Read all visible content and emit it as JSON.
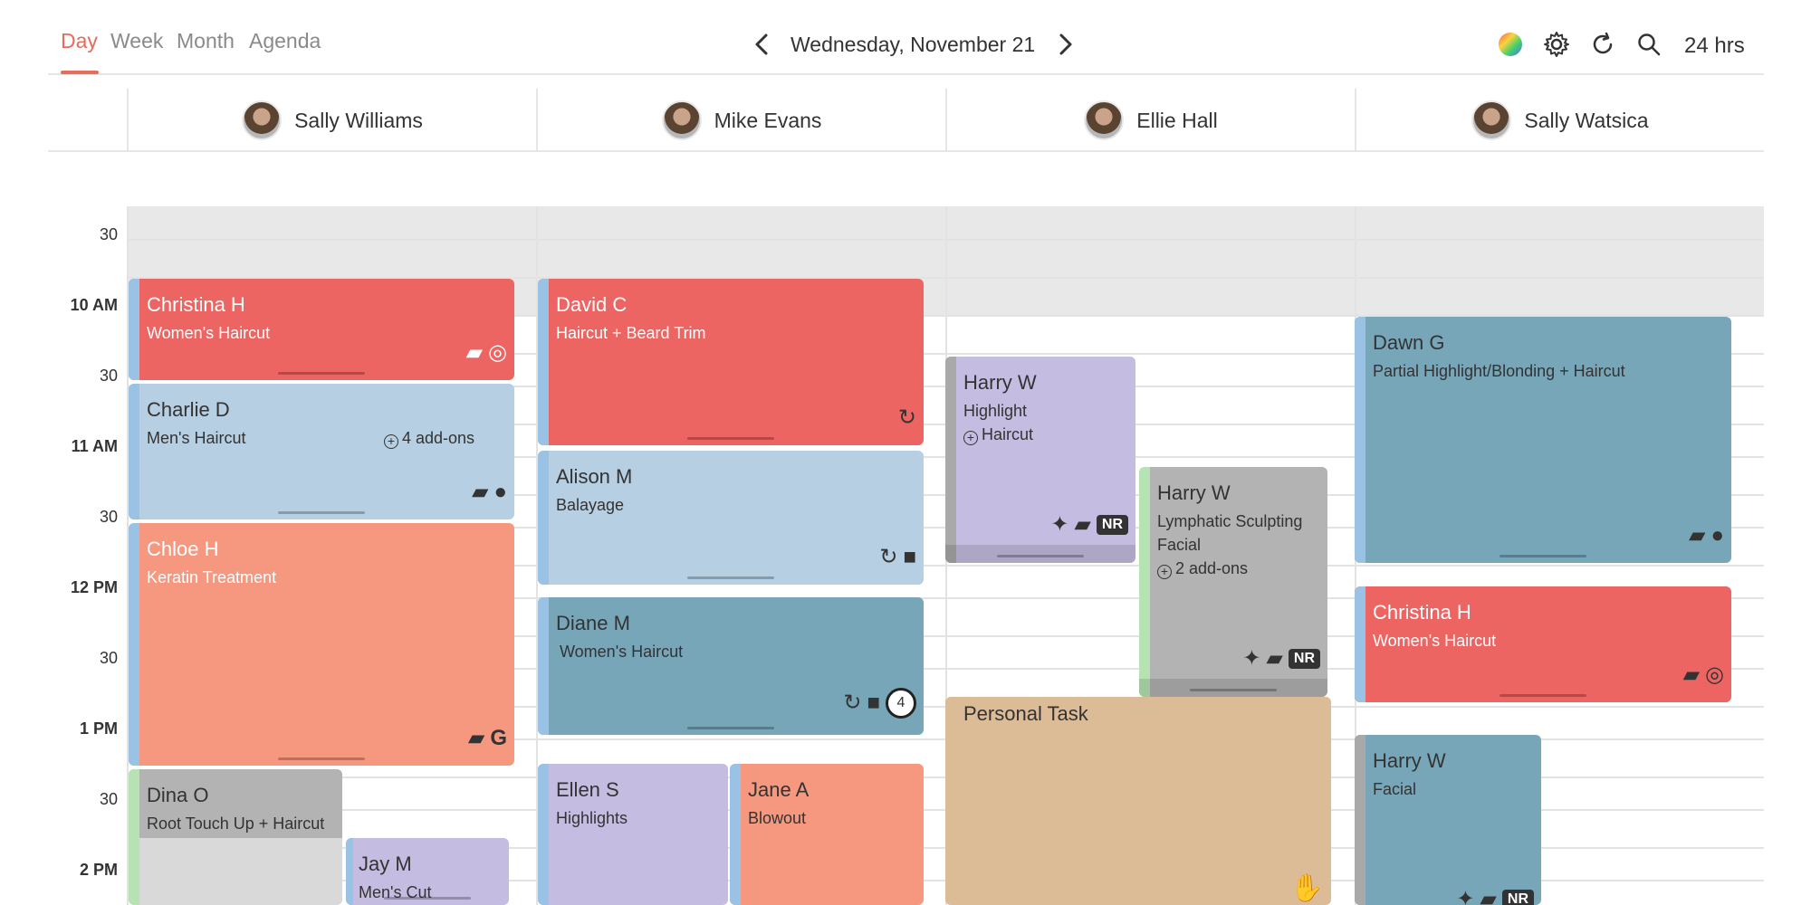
{
  "toolbar": {
    "tabs": [
      "Day",
      "Week",
      "Month",
      "Agenda"
    ],
    "active_tab": "Day",
    "date": "Wednesday, November 21",
    "hours_label": "24 hrs",
    "icons": [
      "color-wheel-icon",
      "gear-icon",
      "refresh-icon",
      "search-icon"
    ]
  },
  "staff": [
    {
      "name": "Sally Williams"
    },
    {
      "name": "Mike Evans"
    },
    {
      "name": "Ellie Hall"
    },
    {
      "name": "Sally Watsica"
    }
  ],
  "time_labels": [
    "30",
    "10 AM",
    "30",
    "11 AM",
    "30",
    "12 PM",
    "30",
    "1 PM",
    "30",
    "2 PM"
  ],
  "colors": {
    "accent": "#e46d5c",
    "red": "#ec6563",
    "light_blue": "#b6cfe2",
    "salmon": "#f69880",
    "grey": "#b3b3b3",
    "lavender": "#c5bde1",
    "teal": "#78a6b9",
    "tan": "#dcbb97"
  },
  "appointments": [
    {
      "client": "Christina H",
      "service": "Women's Haircut",
      "icons": [
        "note-icon",
        "instagram-icon"
      ]
    },
    {
      "client": "Charlie D",
      "service": "Men's Haircut",
      "addons": "4 add-ons",
      "icons": [
        "note-icon",
        "apple-icon"
      ]
    },
    {
      "client": "Chloe H",
      "service": "Keratin Treatment",
      "icons": [
        "note-icon",
        "google-icon"
      ]
    },
    {
      "client": "Dina O",
      "service": "Root Touch Up + Haircut"
    },
    {
      "client": "Jay M",
      "service": "Men's Cut"
    },
    {
      "client": "David C",
      "service": "Haircut + Beard Trim",
      "icons": [
        "recurring-icon"
      ]
    },
    {
      "client": "Alison M",
      "service": "Balayage",
      "icons": [
        "recurring-icon",
        "video-icon"
      ]
    },
    {
      "client": "Diane M",
      "service": "Women's Haircut",
      "count": "4",
      "icons": [
        "recurring-icon",
        "video-icon"
      ]
    },
    {
      "client": "Ellen S",
      "service": "Highlights"
    },
    {
      "client": "Jane A",
      "service": "Blowout"
    },
    {
      "client": "Harry W",
      "service": "Highlight",
      "addon_line": "Haircut",
      "badge": "NR",
      "icons": [
        "sparkle-icon",
        "note-icon"
      ]
    },
    {
      "client": "Harry W",
      "service": "Lymphatic Sculpting",
      "service_line2": "Facial",
      "addons": "2 add-ons",
      "badge": "NR",
      "icons": [
        "sparkle-icon",
        "note-icon"
      ]
    },
    {
      "client": "Personal Task",
      "icons": [
        "hand-icon"
      ]
    },
    {
      "client": "Dawn G",
      "service": "Partial Highlight/Blonding + Haircut",
      "icons": [
        "note-icon",
        "apple-icon"
      ]
    },
    {
      "client": "Christina H",
      "service": "Women's Haircut",
      "icons": [
        "note-icon",
        "instagram-icon"
      ]
    },
    {
      "client": "Harry W",
      "service": "Facial",
      "badge": "NR",
      "icons": [
        "sparkle-icon",
        "note-icon"
      ]
    }
  ]
}
